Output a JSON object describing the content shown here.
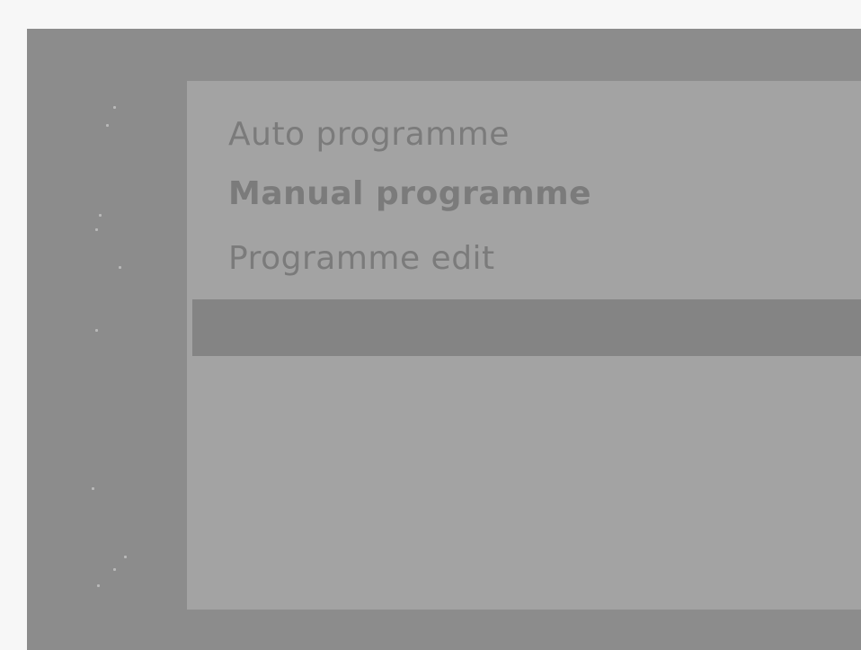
{
  "menu": {
    "items": [
      {
        "label": "Auto programme"
      },
      {
        "label": "Manual programme"
      },
      {
        "label": "Programme edit"
      }
    ]
  }
}
